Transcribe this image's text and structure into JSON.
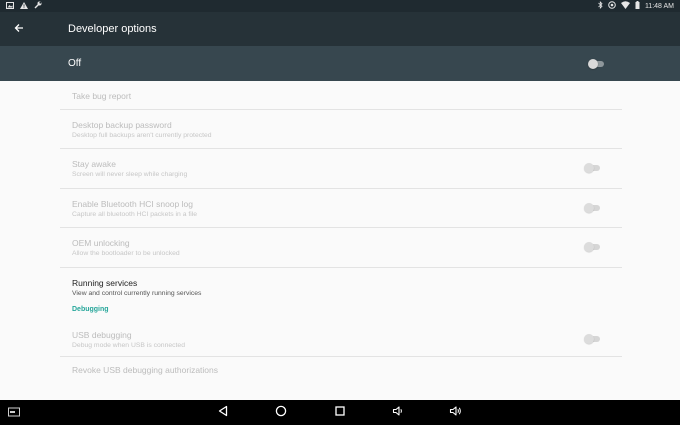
{
  "status_bar": {
    "time": "11:48 AM",
    "left_icons": [
      "gallery-notification-icon",
      "warning-icon",
      "wrench-icon"
    ],
    "right_icons": [
      "bluetooth-icon",
      "hotspot-icon",
      "wifi-icon",
      "battery-icon"
    ]
  },
  "toolbar": {
    "title": "Developer options"
  },
  "master": {
    "label": "Off",
    "checked": false
  },
  "items": [
    {
      "title": "Take bug report",
      "summary": "",
      "enabled": false,
      "has_switch": false
    },
    {
      "title": "Desktop backup password",
      "summary": "Desktop full backups aren't currently protected",
      "enabled": false,
      "has_switch": false
    },
    {
      "title": "Stay awake",
      "summary": "Screen will never sleep while charging",
      "enabled": false,
      "has_switch": true
    },
    {
      "title": "Enable Bluetooth HCI snoop log",
      "summary": "Capture all bluetooth HCI packets in a file",
      "enabled": false,
      "has_switch": true
    },
    {
      "title": "OEM unlocking",
      "summary": "Allow the bootloader to be unlocked",
      "enabled": false,
      "has_switch": true
    },
    {
      "title": "Running services",
      "summary": "View and control currently running services",
      "enabled": true,
      "has_switch": false
    }
  ],
  "debugging": {
    "category": "Debugging",
    "items": [
      {
        "title": "USB debugging",
        "summary": "Debug mode when USB is connected",
        "enabled": false,
        "has_switch": true
      },
      {
        "title": "Revoke USB debugging authorizations",
        "summary": "",
        "enabled": false,
        "has_switch": false
      }
    ]
  },
  "nav_bar": {
    "icons": [
      "screenshot-icon",
      "back-icon",
      "home-icon",
      "recents-icon",
      "volume-down-icon",
      "volume-up-icon"
    ]
  },
  "colors": {
    "toolbar": "#263238",
    "master_bar": "#37474f",
    "accent": "#26a69a",
    "background": "#fafafa"
  }
}
